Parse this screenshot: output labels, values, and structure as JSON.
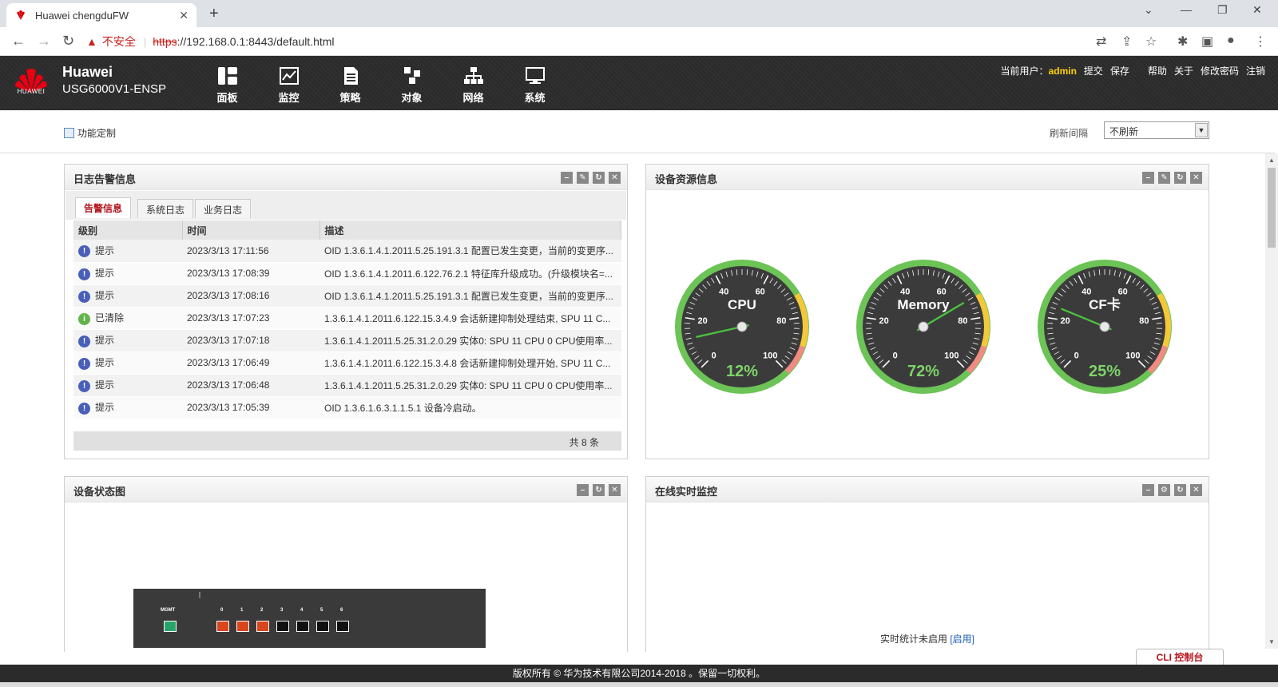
{
  "browser": {
    "tab_title": "Huawei chengduFW",
    "url_insecure_label": "不安全",
    "url_scheme": "https",
    "url_rest": "://192.168.0.1:8443/default.html"
  },
  "header": {
    "brand_name": "Huawei",
    "model": "USG6000V1-ENSP",
    "logo_text": "HUAWEI",
    "nav": [
      {
        "label": "面板",
        "icon": "dashboard-icon"
      },
      {
        "label": "监控",
        "icon": "monitor-icon"
      },
      {
        "label": "策略",
        "icon": "policy-icon"
      },
      {
        "label": "对象",
        "icon": "object-icon"
      },
      {
        "label": "网络",
        "icon": "network-icon"
      },
      {
        "label": "系统",
        "icon": "system-icon"
      }
    ],
    "user_label": "当前用户：",
    "user_name": "admin",
    "links": [
      "提交",
      "保存",
      "帮助",
      "关于",
      "修改密码",
      "注销"
    ]
  },
  "toolbar": {
    "customize_label": "功能定制",
    "refresh_label": "刷新间隔",
    "refresh_value": "不刷新"
  },
  "log_panel": {
    "title": "日志告警信息",
    "tabs": [
      "告警信息",
      "系统日志",
      "业务日志"
    ],
    "columns": [
      "级别",
      "时间",
      "描述"
    ],
    "rows": [
      {
        "level": "提示",
        "type": "warn",
        "time": "2023/3/13 17:11:56",
        "desc": "OID 1.3.6.1.4.1.2011.5.25.191.3.1 配置已发生变更，当前的变更序..."
      },
      {
        "level": "提示",
        "type": "warn",
        "time": "2023/3/13 17:08:39",
        "desc": "OID 1.3.6.1.4.1.2011.6.122.76.2.1 特征库升级成功。(升级模块名=..."
      },
      {
        "level": "提示",
        "type": "warn",
        "time": "2023/3/13 17:08:16",
        "desc": "OID 1.3.6.1.4.1.2011.5.25.191.3.1 配置已发生变更，当前的变更序..."
      },
      {
        "level": "已清除",
        "type": "ok",
        "time": "2023/3/13 17:07:23",
        "desc": "1.3.6.1.4.1.2011.6.122.15.3.4.9 会话新建抑制处理结束, SPU 11 C..."
      },
      {
        "level": "提示",
        "type": "warn",
        "time": "2023/3/13 17:07:18",
        "desc": "1.3.6.1.4.1.2011.5.25.31.2.0.29 实体0: SPU 11 CPU 0 CPU使用率..."
      },
      {
        "level": "提示",
        "type": "warn",
        "time": "2023/3/13 17:06:49",
        "desc": "1.3.6.1.4.1.2011.6.122.15.3.4.8 会话新建抑制处理开始, SPU 11 C..."
      },
      {
        "level": "提示",
        "type": "warn",
        "time": "2023/3/13 17:06:48",
        "desc": "1.3.6.1.4.1.2011.5.25.31.2.0.29 实体0: SPU 11 CPU 0 CPU使用率..."
      },
      {
        "level": "提示",
        "type": "warn",
        "time": "2023/3/13 17:05:39",
        "desc": "OID 1.3.6.1.6.3.1.1.5.1 设备冷启动。"
      }
    ],
    "total": "共 8 条"
  },
  "resource_panel": {
    "title": "设备资源信息",
    "gauges": [
      {
        "name": "CPU",
        "value": 12,
        "label": "12%"
      },
      {
        "name": "Memory",
        "value": 72,
        "label": "72%"
      },
      {
        "name": "CF卡",
        "value": 25,
        "label": "25%"
      }
    ],
    "ticks": [
      "0",
      "20",
      "40",
      "60",
      "80",
      "100"
    ]
  },
  "status_panel": {
    "title": "设备状态图",
    "mgmt_label": "MGMT",
    "ports": [
      {
        "num": "0",
        "state": "up"
      },
      {
        "num": "1",
        "state": "up"
      },
      {
        "num": "2",
        "state": "up"
      },
      {
        "num": "3",
        "state": "down"
      },
      {
        "num": "4",
        "state": "down"
      },
      {
        "num": "5",
        "state": "down"
      },
      {
        "num": "6",
        "state": "down"
      }
    ]
  },
  "monitor_panel": {
    "title": "在线实时监控",
    "message": "实时统计未启用",
    "enable_link": "[启用]"
  },
  "cli_button": "CLI 控制台",
  "footer": "版权所有 © 华为技术有限公司2014-2018 。保留一切权利。"
}
